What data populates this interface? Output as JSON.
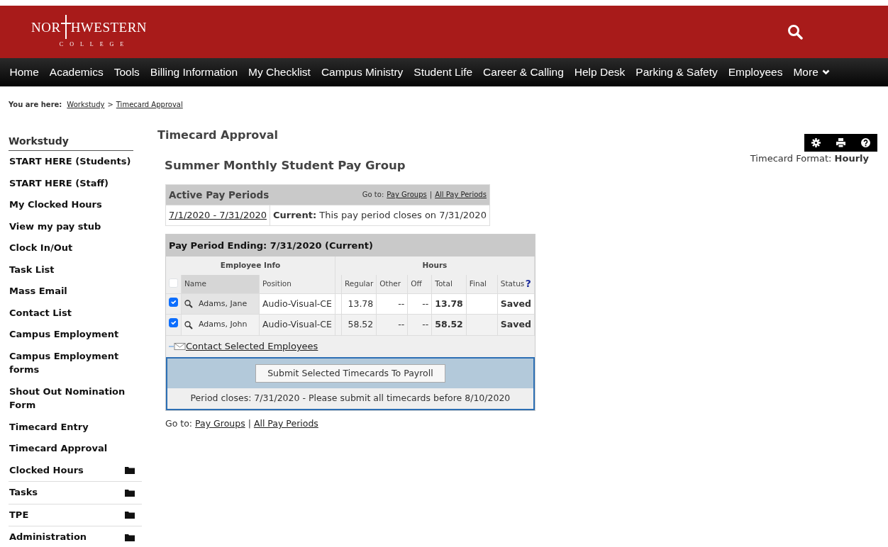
{
  "logo": {
    "before": "NOR",
    "after": "HWESTERN",
    "sub": "COLLEGE"
  },
  "nav": [
    "Home",
    "Academics",
    "Tools",
    "Billing Information",
    "My Checklist",
    "Campus Ministry",
    "Student Life",
    "Career & Calling",
    "Help Desk",
    "Parking & Safety",
    "Employees",
    "More"
  ],
  "breadcrumb": {
    "label": "You are here:",
    "items": [
      "Workstudy",
      "Timecard Approval"
    ],
    "separator": ">"
  },
  "sidebar": {
    "title": "Workstudy",
    "items": [
      {
        "label": "START HERE (Students)",
        "kind": "link"
      },
      {
        "label": "START HERE (Staff)",
        "kind": "link"
      },
      {
        "label": "My Clocked Hours",
        "kind": "link"
      },
      {
        "label": "View my pay stub",
        "kind": "link"
      },
      {
        "label": "Clock In/Out",
        "kind": "link"
      },
      {
        "label": "Task List",
        "kind": "link"
      },
      {
        "label": "Mass Email",
        "kind": "link"
      },
      {
        "label": "Contact List",
        "kind": "link"
      },
      {
        "label": "Campus Employment",
        "kind": "link"
      },
      {
        "label": "Campus Employment forms",
        "kind": "link"
      },
      {
        "label": "Shout Out Nomination Form",
        "kind": "link"
      },
      {
        "label": "Timecard Entry",
        "kind": "link"
      },
      {
        "label": "Timecard Approval",
        "kind": "link"
      },
      {
        "label": "Clocked Hours",
        "kind": "folder"
      },
      {
        "label": "Tasks",
        "kind": "folder"
      },
      {
        "label": "TPE",
        "kind": "folder"
      },
      {
        "label": "Administration",
        "kind": "folder"
      }
    ]
  },
  "page_title": "Timecard Approval",
  "group_title": "Summer Monthly Student Pay Group",
  "timecard_format": {
    "label": "Timecard Format:",
    "value": "Hourly"
  },
  "active_periods": {
    "title": "Active Pay Periods",
    "goto_label": "Go to:",
    "goto_links": [
      "Pay Groups",
      "All Pay Periods"
    ],
    "goto_separator": "|",
    "period": "7/1/2020 - 7/31/2020",
    "status_label": "Current:",
    "status_text": "This pay period closes on 7/31/2020"
  },
  "pay_period": {
    "title": "Pay Period Ending: 7/31/2020 (Current)",
    "groups": [
      "Employee Info",
      "Hours"
    ],
    "columns": [
      "Name",
      "Position",
      "Regular",
      "Other",
      "Off",
      "Total",
      "Final",
      "Status"
    ],
    "help": "?",
    "all_checked": false,
    "rows": [
      {
        "checked": true,
        "name": "Adams, Jane",
        "position": "Audio-Visual-CE",
        "regular": "13.78",
        "other": "--",
        "off": "--",
        "total": "13.78",
        "status": "Saved"
      },
      {
        "checked": true,
        "name": "Adams, John",
        "position": "Audio-Visual-CE",
        "regular": "58.52",
        "other": "--",
        "off": "--",
        "total": "58.52",
        "status": "Saved"
      }
    ],
    "contact_link": "Contact Selected Employees",
    "submit_button": "Submit Selected Timecards To Payroll",
    "note": "Period closes: 7/31/2020 - Please submit all timecards before 8/10/2020"
  },
  "footer_goto": {
    "label": "Go to:",
    "links": [
      "Pay Groups",
      "All Pay Periods"
    ],
    "separator": "|"
  }
}
